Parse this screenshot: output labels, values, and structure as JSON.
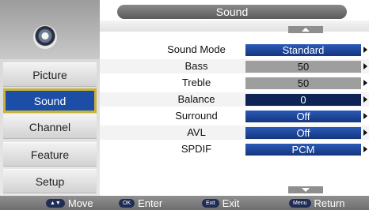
{
  "header": {
    "title": "Sound"
  },
  "sidebar": {
    "logo_icon": "disc-icon",
    "items": [
      {
        "label": "Picture",
        "active": false
      },
      {
        "label": "Sound",
        "active": true
      },
      {
        "label": "Channel",
        "active": false
      },
      {
        "label": "Feature",
        "active": false
      },
      {
        "label": "Setup",
        "active": false
      }
    ]
  },
  "settings": [
    {
      "label": "Sound Mode",
      "value": "Standard"
    },
    {
      "label": "Bass",
      "value": "50"
    },
    {
      "label": "Treble",
      "value": "50"
    },
    {
      "label": "Balance",
      "value": "0"
    },
    {
      "label": "Surround",
      "value": "Off"
    },
    {
      "label": "AVL",
      "value": "Off"
    },
    {
      "label": "SPDIF",
      "value": "PCM"
    }
  ],
  "footer": {
    "move": {
      "key": "▲▼",
      "label": "Move"
    },
    "enter": {
      "key": "OK",
      "label": "Enter"
    },
    "exit": {
      "key": "Exit",
      "label": "Exit"
    },
    "return": {
      "key": "Menu",
      "label": "Return"
    }
  },
  "colors": {
    "accent_blue": "#1c4ea8",
    "selection_border": "#c8b23a",
    "value_gray": "#9e9e9e"
  }
}
